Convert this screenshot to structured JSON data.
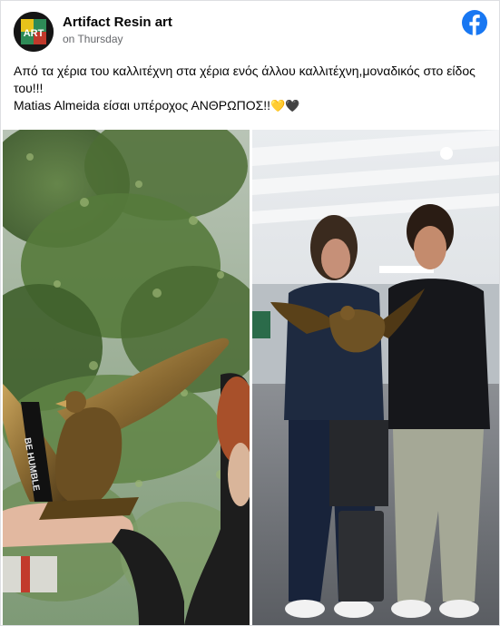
{
  "post": {
    "page_name": "Artifact Resin art",
    "time": "on Thursday",
    "text_line1": "Από τα χέρια του καλλιτέχνη στα χέρια ενός άλλου καλλιτέχνη,μοναδικός στο είδος του!!!",
    "text_line2": "Matias Almeida είσαι υπέροχος ΑΝΘΡΩΠΟΣ!!",
    "emojis": "💛🖤",
    "avatar_text": "ART"
  },
  "photos": {
    "left_scarf_text": "BE HUMBLE"
  },
  "colors": {
    "facebook_blue": "#1877f2",
    "text": "#050505",
    "meta": "#65676b"
  },
  "icons": {
    "brand": "facebook-logo-icon"
  }
}
